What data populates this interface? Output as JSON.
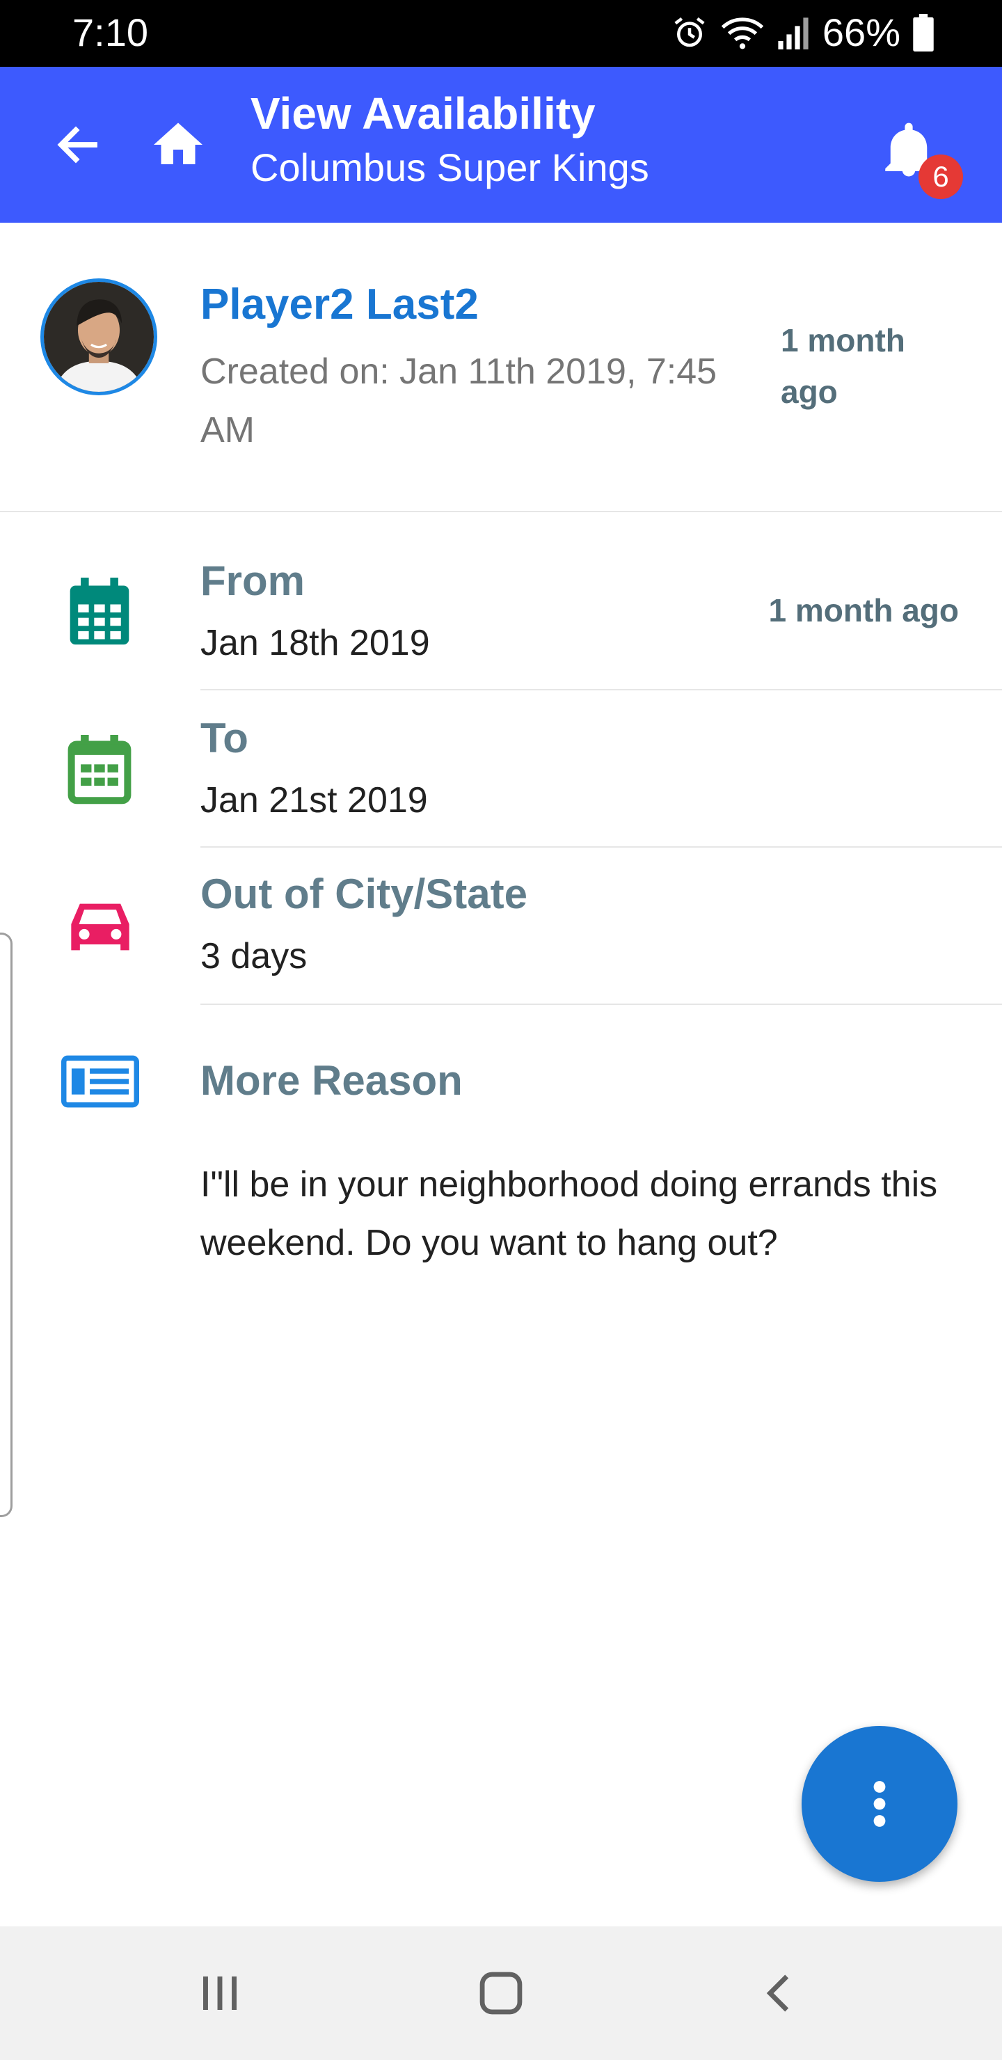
{
  "status_bar": {
    "time": "7:10",
    "battery_percent": "66%",
    "icons": [
      "alarm-icon",
      "wifi-icon",
      "signal-icon",
      "battery-icon"
    ]
  },
  "app_bar": {
    "title": "View Availability",
    "subtitle": "Columbus Super Kings",
    "notification_count": "6",
    "icons": [
      "back-arrow-icon",
      "home-icon",
      "bell-icon"
    ],
    "accent_color": "#3d5afe"
  },
  "profile": {
    "name": "Player2 Last2",
    "created_on": "Created on: Jan 11th 2019, 7:45 AM",
    "relative_time": "1 month ago"
  },
  "details": {
    "from": {
      "label": "From",
      "value": "Jan 18th 2019",
      "relative_time": "1 month ago",
      "icon": "calendar-icon",
      "icon_color": "#00897b"
    },
    "to": {
      "label": "To",
      "value": "Jan 21st 2019",
      "icon": "calendar-icon",
      "icon_color": "#43a047"
    },
    "out_of_city": {
      "label": "Out of City/State",
      "value": "3 days",
      "icon": "car-icon",
      "icon_color": "#e91e63"
    },
    "more_reason": {
      "label": "More Reason",
      "value": "I\"ll be in your neighborhood doing errands this weekend. Do you want to hang out?",
      "icon": "article-icon",
      "icon_color": "#1e88e5"
    }
  },
  "fab": {
    "icon": "more-vert-icon",
    "color": "#1976d2"
  },
  "nav_bar": {
    "icons": [
      "recents-icon",
      "home-nav-icon",
      "back-nav-icon"
    ]
  }
}
